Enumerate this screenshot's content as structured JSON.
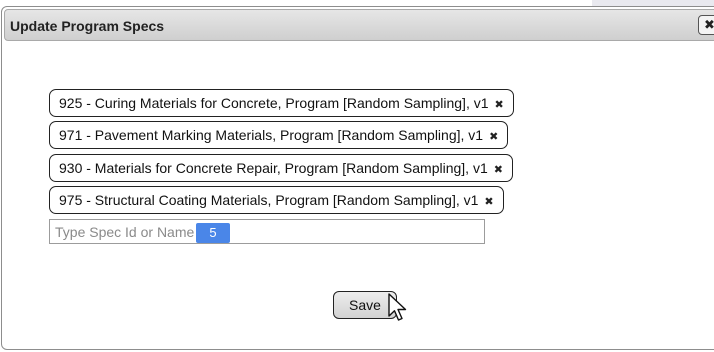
{
  "dialog": {
    "title": "Update Program Specs",
    "close_glyph": "✖"
  },
  "specs": {
    "selected": [
      {
        "label": "925 - Curing Materials for Concrete, Program [Random Sampling], v1",
        "remove_glyph": "✖"
      },
      {
        "label": "971 - Pavement Marking Materials, Program [Random Sampling], v1",
        "remove_glyph": "✖"
      },
      {
        "label": "930 - Materials for Concrete Repair, Program [Random Sampling], v1",
        "remove_glyph": "✖"
      },
      {
        "label": "975 - Structural Coating Materials, Program [Random Sampling], v1",
        "remove_glyph": "✖"
      }
    ],
    "input": {
      "value": "",
      "placeholder": "Type Spec Id or Name"
    },
    "count_badge": "5"
  },
  "actions": {
    "save_label": "Save"
  },
  "icons": {
    "remove": "close-icon",
    "cursor": "mouse-pointer-icon"
  },
  "colors": {
    "badge": "#4a86e8",
    "titlebar": "#d9d9d9"
  }
}
